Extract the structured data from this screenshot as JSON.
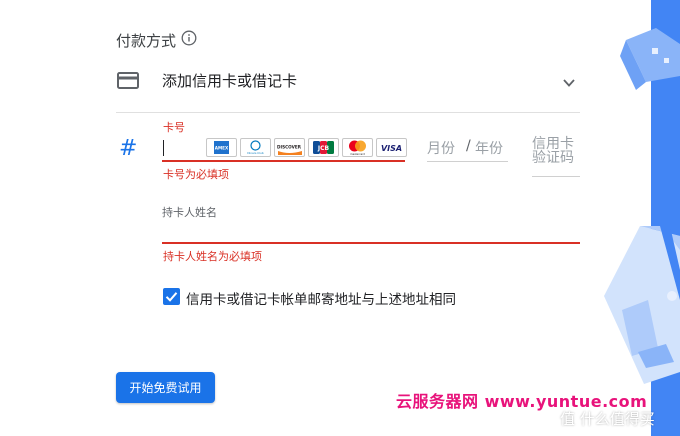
{
  "payment": {
    "section_title": "付款方式",
    "add_card_label": "添加信用卡或借记卡"
  },
  "card_number": {
    "label": "卡号",
    "error": "卡号为必填项",
    "logos": [
      "AMEX",
      "Diners Club",
      "DISCOVER",
      "JCB",
      "mastercard",
      "VISA"
    ]
  },
  "expiry": {
    "month_placeholder": "月份",
    "separator": "/",
    "year_placeholder": "年份"
  },
  "cvc": {
    "placeholder": "信用卡验证码"
  },
  "cardholder": {
    "label": "持卡人姓名",
    "error": "持卡人姓名为必填项"
  },
  "billing": {
    "same_address_label": "信用卡或借记卡帐单邮寄地址与上述地址相同",
    "checked": true
  },
  "actions": {
    "start_trial_label": "开始免费试用"
  },
  "watermarks": {
    "site_banner": "云服务器网 www.yuntue.com",
    "corner_brand": "值 什么值得买"
  },
  "colors": {
    "accent": "#1a73e8",
    "error": "#d93025",
    "watermark": "#e8137b",
    "panel": "#4285f4"
  },
  "icons": {
    "info": "info-circle-icon",
    "card": "credit-card-icon",
    "chevron": "chevron-down-icon",
    "hash": "hash-icon",
    "check": "checkmark-icon"
  }
}
